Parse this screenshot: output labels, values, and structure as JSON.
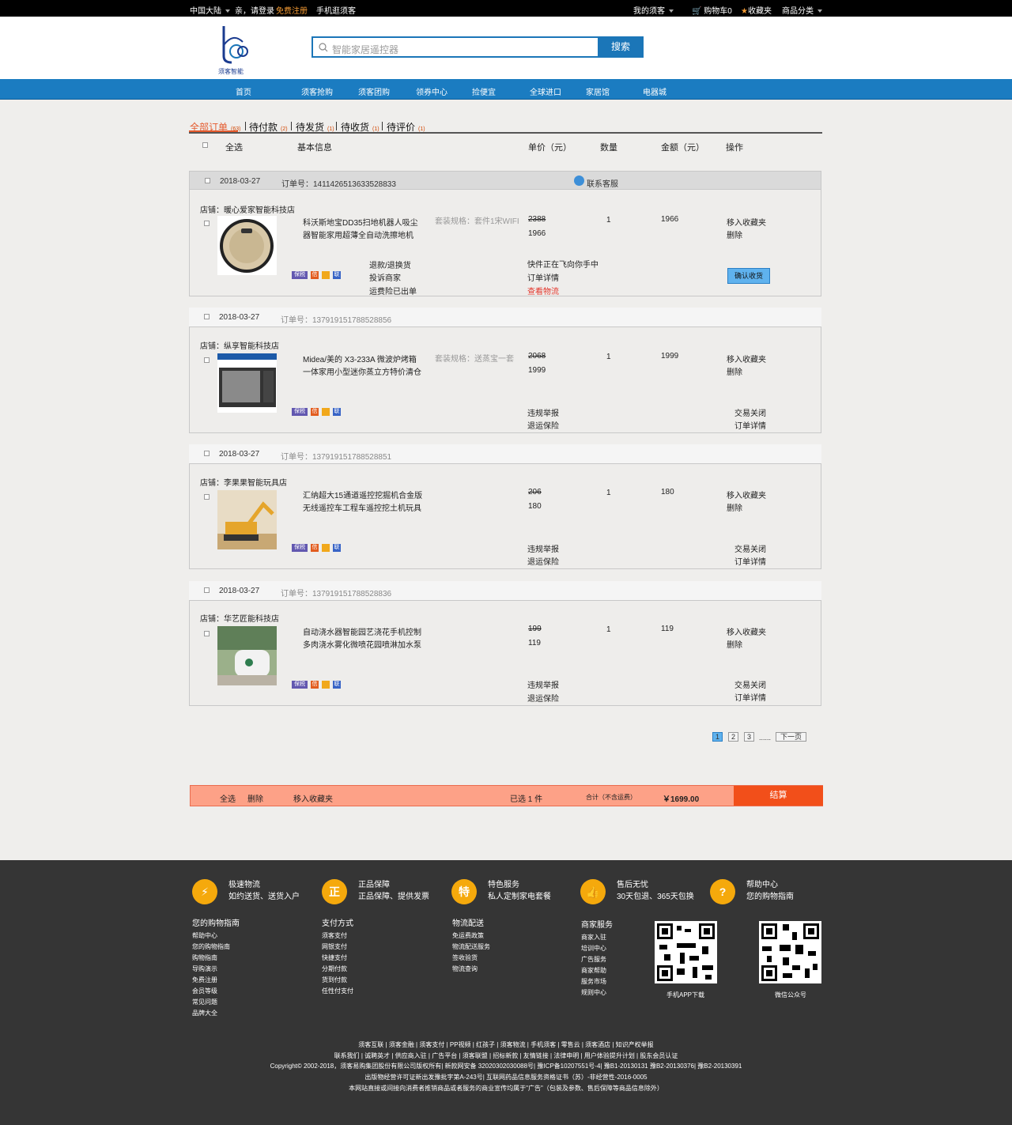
{
  "topbar": {
    "region": "中国大陆",
    "greeting": "亲，请登录",
    "register": "免费注册",
    "mobile": "手机逛须客",
    "my_account": "我的须客",
    "cart": "购物车0",
    "favorites": "收藏夹",
    "categories": "商品分类"
  },
  "logo": {
    "text": "须客智能"
  },
  "search": {
    "placeholder": "智能家居遥控器",
    "button": "搜索"
  },
  "nav": [
    "首页",
    "须客抢购",
    "须客团购",
    "领券中心",
    "捡便宜",
    "全球进口",
    "家居馆",
    "电器城"
  ],
  "tabs": [
    {
      "label": "全部订单",
      "count": "(63)"
    },
    {
      "label": "待付款",
      "count": "(2)"
    },
    {
      "label": "待发货",
      "count": "(1)"
    },
    {
      "label": "待收货",
      "count": "(1)"
    },
    {
      "label": "待评价",
      "count": "(1)"
    }
  ],
  "columns": {
    "select_all": "全选",
    "basic_info": "基本信息",
    "unit_price": "单价（元）",
    "quantity": "数量",
    "amount": "金额（元）",
    "action": "操作"
  },
  "badges": [
    "保税",
    "信",
    "",
    "联"
  ],
  "orders": [
    {
      "date": "2018-03-27",
      "order_no": "订单号：1411426513633528833",
      "contact": "联系客服",
      "shop": "店铺：暖心爱家智能科技店",
      "title1": "科沃斯地宝DD35扫地机器人吸尘",
      "title2": "器智能家用超薄全自动洗擦地机",
      "spec": "套装规格：套件1宋WIFI",
      "orig_price": "2388",
      "price": "1966",
      "qty": "1",
      "amount": "1966",
      "op1": "移入收藏夹",
      "op2": "删除",
      "links": [
        "退款/退换货",
        "投诉商家",
        "运费险已出单"
      ],
      "status": [
        "快件正在飞向你手中",
        "订单详情",
        "查看物流"
      ],
      "confirm": "确认收货"
    },
    {
      "date": "2018-03-27",
      "order_no": "订单号：137919151788528856",
      "shop": "店铺：纵享智能科技店",
      "title1": "Midea/美的 X3-233A 微波炉烤箱",
      "title2": "一体家用小型迷你蒸立方特价清仓",
      "spec": "套装规格：送蒸宝一套",
      "orig_price": "2068",
      "price": "1999",
      "qty": "1",
      "amount": "1999",
      "op1": "移入收藏夹",
      "op2": "删除",
      "links": [
        "违规举报",
        "退运保险"
      ],
      "status": [
        "交易关闭",
        "订单详情"
      ]
    },
    {
      "date": "2018-03-27",
      "order_no": "订单号：137919151788528851",
      "shop": "店铺：李果果智能玩具店",
      "title1": "汇纳超大15通道遥控挖掘机合金版",
      "title2": "无线遥控车工程车遥控挖土机玩具",
      "spec": "",
      "orig_price": "206",
      "price": "180",
      "qty": "1",
      "amount": "180",
      "op1": "移入收藏夹",
      "op2": "删除",
      "links": [
        "违规举报",
        "退运保险"
      ],
      "status": [
        "交易关闭",
        "订单详情"
      ]
    },
    {
      "date": "2018-03-27",
      "order_no": "订单号：137919151788528836",
      "shop": "店铺：华艺匠能科技店",
      "title1": "自动浇水器智能园艺浇花手机控制",
      "title2": "多肉浇水雾化微喷花园喷淋加水泵",
      "spec": "",
      "orig_price": "199",
      "price": "119",
      "qty": "1",
      "amount": "119",
      "op1": "移入收藏夹",
      "op2": "删除",
      "links": [
        "违规举报",
        "退运保险"
      ],
      "status": [
        "交易关闭",
        "订单详情"
      ]
    }
  ],
  "pagination": {
    "pages": [
      "1",
      "2",
      "3"
    ],
    "ellipsis": "......",
    "next": "下一页",
    "current": "1"
  },
  "paybar": {
    "select_all": "全选",
    "delete": "删除",
    "move_fav": "移入收藏夹",
    "selected": "已选 1 件",
    "total_label": "合计（不含运费）",
    "total": "￥1699.00",
    "checkout": "结算"
  },
  "footer": {
    "services": [
      {
        "icon": "⚡",
        "t1": "极速物流",
        "t2": "如约送货、送货入户"
      },
      {
        "icon": "正",
        "t1": "正品保障",
        "t2": "正品保障、提供发票"
      },
      {
        "icon": "特",
        "t1": "特色服务",
        "t2": "私人定制家电套餐"
      },
      {
        "icon": "👍",
        "t1": "售后无忧",
        "t2": "30天包退、365天包换"
      },
      {
        "icon": "?",
        "t1": "帮助中心",
        "t2": "您的购物指南"
      }
    ],
    "columns": [
      {
        "title": "您的购物指南",
        "items": [
          "帮助中心",
          "您的购物指南",
          "购物指南",
          "导购演示",
          "免费注册",
          "会员等级",
          "常见问题",
          "品牌大全"
        ]
      },
      {
        "title": "支付方式",
        "items": [
          "须客支付",
          "网银支付",
          "快捷支付",
          "分期付款",
          "货到付款",
          "任性付支付"
        ]
      },
      {
        "title": "物流配送",
        "items": [
          "免运费政策",
          "物流配送服务",
          "签收验货",
          "物流查询"
        ]
      },
      {
        "title": "商家服务",
        "items": [
          "商家入驻",
          "培训中心",
          "广告服务",
          "商家帮助",
          "服务市场",
          "规则中心"
        ]
      }
    ],
    "qr": [
      "手机APP下载",
      "微信公众号"
    ],
    "links1": "须客互联 | 须客金融 | 须客支付 | PP视频 | 红孩子 | 须客物流 | 手机须客 | 零售云 | 须客酒店 | 知识产权举报",
    "links2": "联系我们 | 诚聘英才 | 供应商入驻 | 广告平台 | 须客联盟 | 招标新款 | 友情链接 | 法律申明 | 用户体验提升计划 | 股东会员认证",
    "copyright": "Copyright© 2002-2018，须客易购集团股份有限公司版权所有| 新款网安备 32020302030088号| 豫ICP备10207551号-4| 豫B1-20130131 豫B2-20130376| 豫B2-20130391",
    "license": "出版物经营许可证新出发豫批字第A-243号| 互联网药品信息服务资格证书（苏）-非经营性-2016-0005",
    "notice": "本网站直接或间接向消费者推销商品或者服务的商业宣传均属于\"广告\"（包装及参数、售后保障等商品信息除外）"
  }
}
